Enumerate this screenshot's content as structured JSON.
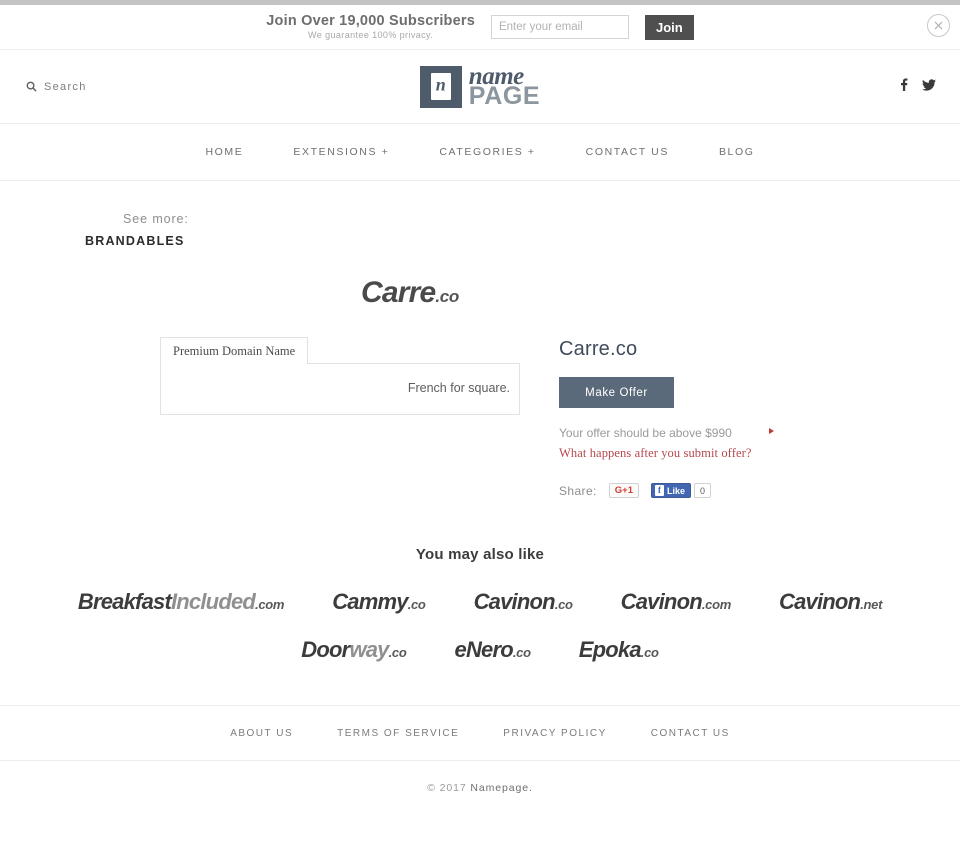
{
  "subscribe": {
    "title": "Join Over 19,000 Subscribers",
    "subtitle": "We guarantee 100% privacy.",
    "email_placeholder": "Enter your email",
    "email_value": "",
    "join_label": "Join",
    "close_icon": "close-circle-icon"
  },
  "header": {
    "search_label": "Search",
    "search_icon": "search-icon",
    "logo": {
      "mark_letter": "n",
      "name": "name",
      "page": "PAGE"
    },
    "social": [
      {
        "name": "facebook-icon",
        "label": "f"
      },
      {
        "name": "twitter-icon",
        "label": "t"
      }
    ]
  },
  "nav": {
    "items": [
      {
        "label": "HOME"
      },
      {
        "label": "EXTENSIONS +"
      },
      {
        "label": "CATEGORIES +"
      },
      {
        "label": "CONTACT US"
      },
      {
        "label": "BLOG"
      }
    ]
  },
  "see_more": {
    "label": "See more:",
    "category": "BRANDABLES"
  },
  "hero": {
    "name": "Carre",
    "tld": ".co"
  },
  "details": {
    "tab_label": "Premium Domain Name",
    "description": "French for square."
  },
  "offer": {
    "domain_title": "Carre.co",
    "button_label": "Make Offer",
    "note": "Your offer should be above $990",
    "minimum_price": "$990",
    "link_label": "What happens after you submit offer?",
    "share_label": "Share:",
    "gplus_label": "G+1",
    "fb_like_label": "Like",
    "fb_count": "0"
  },
  "also_like": {
    "title": "You may also like",
    "items": [
      {
        "part_a": "Breakfast",
        "part_b": "Included",
        "tld": ".com"
      },
      {
        "part_a": "Cammy",
        "part_b": "",
        "tld": ".co"
      },
      {
        "part_a": "Cavinon",
        "part_b": "",
        "tld": ".co"
      },
      {
        "part_a": "Cavinon",
        "part_b": "",
        "tld": ".com"
      },
      {
        "part_a": "Cavinon",
        "part_b": "",
        "tld": ".net"
      },
      {
        "part_a": "Door",
        "part_b": "way",
        "tld": ".co"
      },
      {
        "part_a": "eNero",
        "part_b": "",
        "tld": ".co"
      },
      {
        "part_a": "Epoka",
        "part_b": "",
        "tld": ".co"
      }
    ]
  },
  "footer": {
    "links": [
      {
        "label": "ABOUT US"
      },
      {
        "label": "TERMS OF SERVICE"
      },
      {
        "label": "PRIVACY POLICY"
      },
      {
        "label": "CONTACT US"
      }
    ],
    "copyright_prefix": "© 2017 ",
    "copyright_brand": "Namepage."
  },
  "colors": {
    "logo_navy": "#4e5b6b",
    "button_slate": "#5b6a7a",
    "accent_red": "#b5484f",
    "facebook_blue": "#4267b2",
    "gplus_red": "#d73d32"
  }
}
